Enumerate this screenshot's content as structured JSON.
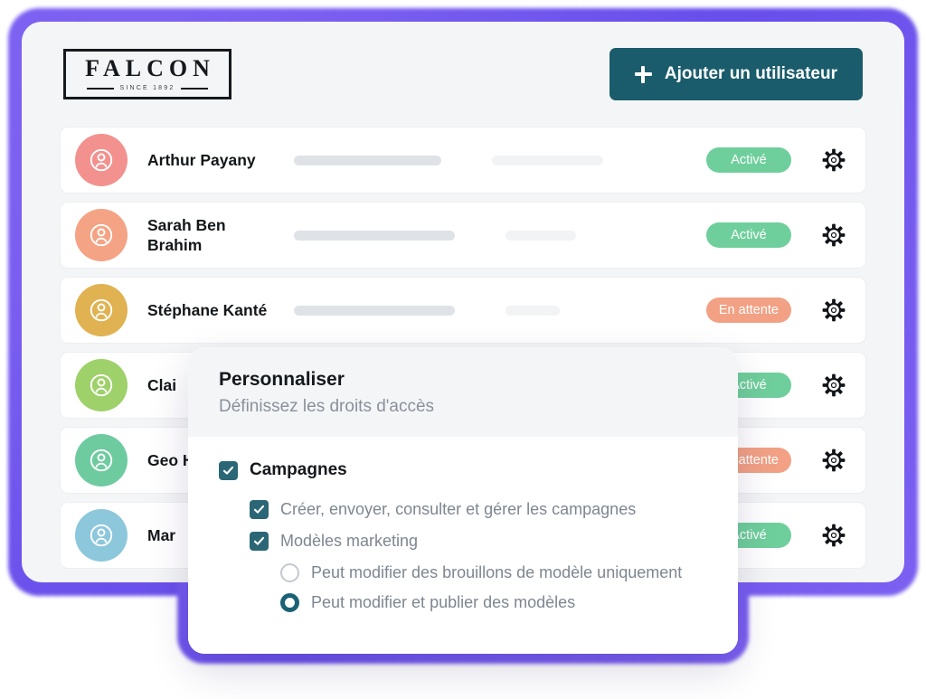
{
  "brand": {
    "logo_word": "FALCON",
    "logo_subtitle": "SINCE 1892"
  },
  "header": {
    "add_user_label": "Ajouter un utilisateur",
    "add_user_icon": "plus-icon",
    "add_user_color": "#1a5c6b"
  },
  "colors": {
    "page_background": "#ffffff",
    "card_background": "#f4f5f6",
    "row_background": "#ffffff",
    "glow": "#6246e8",
    "accent_teal": "#1a5c6b",
    "badge_active": "#6fcf9c",
    "badge_pending": "#f2a185",
    "checkbox": "#2b6676",
    "skeleton_dark": "#dfe3e7",
    "skeleton_light": "#f2f3f4"
  },
  "users": [
    {
      "name": "Arthur Payany",
      "avatar_color": "#f3918f",
      "avatar_icon": "user-avatar-icon",
      "status": "Activé",
      "status_type": "active",
      "skeleton_primary_width": 163,
      "skeleton_secondary_width": 123
    },
    {
      "name": "Sarah Ben Brahim",
      "avatar_color": "#f4a384",
      "avatar_icon": "user-avatar-icon",
      "status": "Activé",
      "status_type": "active",
      "skeleton_primary_width": 178,
      "skeleton_secondary_width": 78
    },
    {
      "name": "Stéphane Kanté",
      "avatar_color": "#e0b martial",
      "avatar_color_hex": "#e0b252",
      "avatar_icon": "user-avatar-icon",
      "status": "En attente",
      "status_type": "pending",
      "skeleton_primary_width": 178,
      "skeleton_secondary_width": 60
    },
    {
      "name": "Clai",
      "avatar_color_hex": "#9ed16a",
      "avatar_icon": "user-avatar-icon",
      "status": "Activé",
      "status_type": "active",
      "skeleton_primary_width": 170,
      "skeleton_secondary_width": 90
    },
    {
      "name": "Geo Her",
      "avatar_color_hex": "#6ecba0",
      "avatar_icon": "user-avatar-icon",
      "status": "En attente",
      "status_type": "pending",
      "skeleton_primary_width": 170,
      "skeleton_secondary_width": 90
    },
    {
      "name": "Mar",
      "avatar_color_hex": "#8cc7dc",
      "avatar_icon": "user-avatar-icon",
      "status": "Activé",
      "status_type": "active",
      "skeleton_primary_width": 170,
      "skeleton_secondary_width": 90
    }
  ],
  "row_action_icon": "gear-icon",
  "modal": {
    "title": "Personnaliser",
    "subtitle": "Définissez les droits d'accès",
    "group": {
      "label": "Campagnes",
      "checked": true
    },
    "children": [
      {
        "label": "Créer, envoyer, consulter et gérer les campagnes",
        "checked": true
      },
      {
        "label": "Modèles marketing",
        "checked": true
      }
    ],
    "radios": [
      {
        "label": "Peut modifier des brouillons de modèle uniquement",
        "selected": false
      },
      {
        "label": "Peut modifier et publier des modèles",
        "selected": true
      }
    ]
  }
}
